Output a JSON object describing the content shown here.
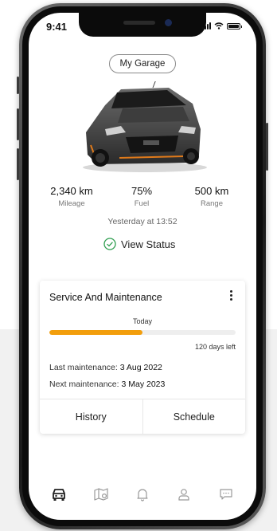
{
  "status_bar": {
    "time": "9:41"
  },
  "header": {
    "garage_label": "My Garage"
  },
  "vehicle": {
    "image_icon": "car-image"
  },
  "stats": [
    {
      "value": "2,340 km",
      "label": "Mileage"
    },
    {
      "value": "75%",
      "label": "Fuel"
    },
    {
      "value": "500 km",
      "label": "Range"
    }
  ],
  "updated_text": "Yesterday at 13:52",
  "view_status_label": "View Status",
  "service_card": {
    "title": "Service And Maintenance",
    "today_label": "Today",
    "progress_fraction": 0.5,
    "days_left": "120 days left",
    "last_maintenance_label": "Last maintenance:",
    "last_maintenance_date": "3 Aug 2022",
    "next_maintenance_label": "Next maintenance:",
    "next_maintenance_date": "3 May 2023",
    "history_label": "History",
    "schedule_label": "Schedule"
  },
  "bottom_nav": [
    "car-icon",
    "map-icon",
    "bell-icon",
    "user-icon",
    "chat-icon"
  ],
  "colors": {
    "accent": "#f29e0c",
    "check": "#2e9e4f"
  }
}
